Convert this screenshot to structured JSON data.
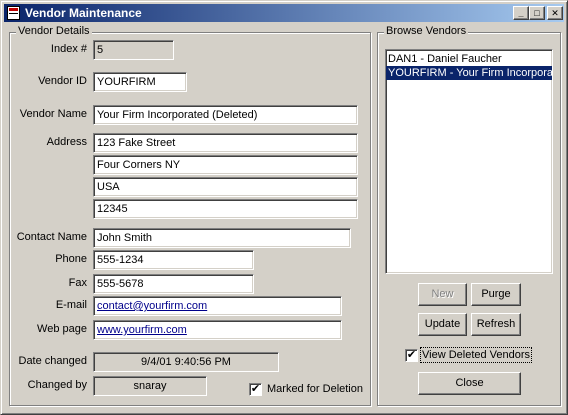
{
  "window": {
    "title": "Vendor Maintenance",
    "min_glyph": "_",
    "max_glyph": "□",
    "close_glyph": "✕"
  },
  "details": {
    "group_label": "Vendor Details",
    "index_label": "Index #",
    "index_value": "5",
    "vendor_id_label": "Vendor ID",
    "vendor_id_value": "YOURFIRM",
    "vendor_name_label": "Vendor Name",
    "vendor_name_value": "Your Firm Incorporated (Deleted)",
    "address_label": "Address",
    "address_lines": [
      "123 Fake Street",
      "Four Corners NY",
      "USA",
      "12345"
    ],
    "contact_label": "Contact Name",
    "contact_value": "John Smith",
    "phone_label": "Phone",
    "phone_value": "555-1234",
    "fax_label": "Fax",
    "fax_value": "555-5678",
    "email_label": "E-mail",
    "email_value": "contact@yourfirm.com",
    "web_label": "Web page",
    "web_value": "www.yourfirm.com",
    "date_changed_label": "Date changed",
    "date_changed_value": "9/4/01 9:40:56 PM",
    "changed_by_label": "Changed by",
    "changed_by_value": "snaray",
    "marked_label": "Marked for Deletion",
    "marked_checked": "✔"
  },
  "browse": {
    "group_label": "Browse Vendors",
    "items": [
      "DAN1 - Daniel Faucher",
      "YOURFIRM - Your Firm Incorporated"
    ],
    "new_label": "New",
    "purge_label": "Purge",
    "update_label": "Update",
    "refresh_label": "Refresh",
    "view_deleted_label": "View Deleted Vendors",
    "view_deleted_checked": "✔",
    "close_label": "Close"
  }
}
